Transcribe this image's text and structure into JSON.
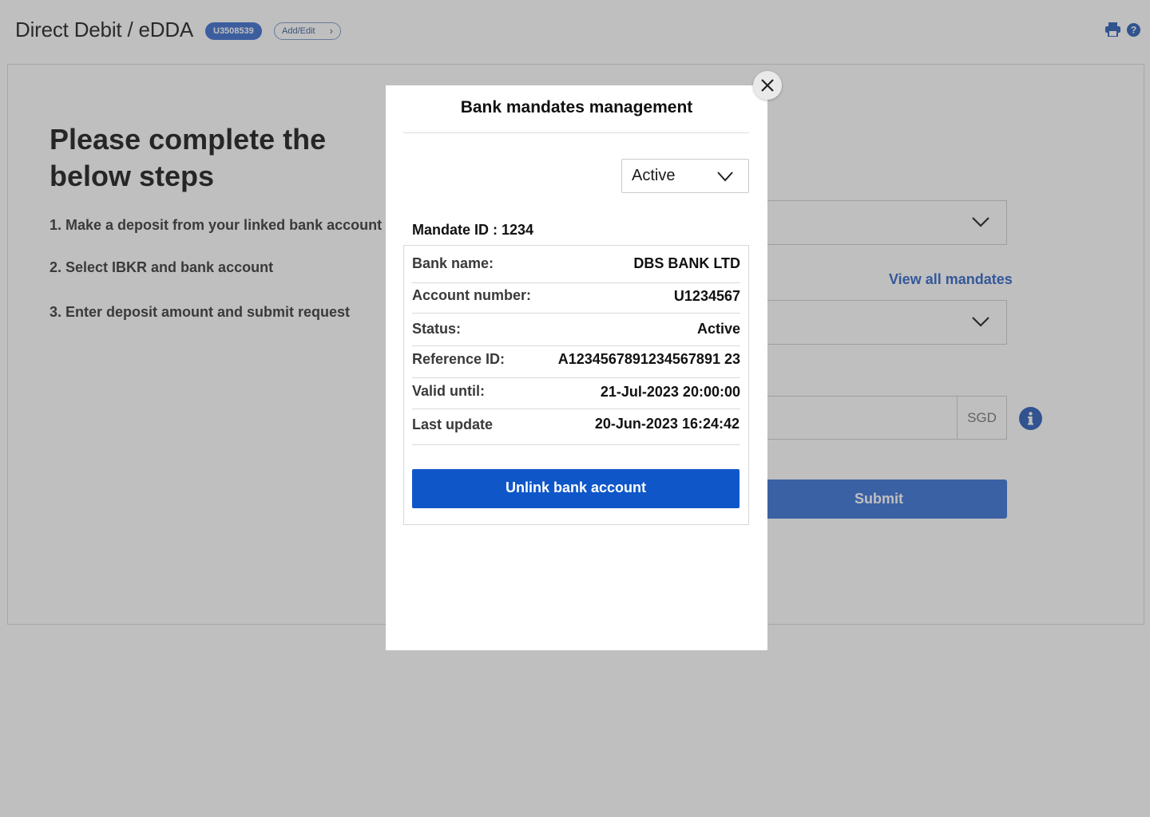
{
  "header": {
    "title": "Direct Debit / eDDA",
    "account_id": "U3508539",
    "add_edit_label": "Add/Edit"
  },
  "main": {
    "steps_title": "Please complete the below steps",
    "steps": [
      "1. Make a deposit from your linked bank account",
      "2. Select IBKR and bank account",
      "3. Enter deposit amount and submit request"
    ],
    "view_all_mandates_label": "View all mandates",
    "currency": "SGD",
    "submit_label": "Submit"
  },
  "modal": {
    "title": "Bank mandates management",
    "status_filter": "Active",
    "mandate_id_text": "Mandate ID : 1234",
    "details": [
      {
        "label": "Bank name:",
        "value": "DBS BANK LTD"
      },
      {
        "label": "Account number:",
        "value": "U1234567"
      },
      {
        "label": "Status:",
        "value": "Active"
      },
      {
        "label": "Reference ID:",
        "value": "A1234567891234567891 23"
      },
      {
        "label": "Valid until:",
        "value": "21-Jul-2023 20:00:00"
      },
      {
        "label": "Last update",
        "value": "20-Jun-2023 16:24:42"
      }
    ],
    "unlink_label": "Unlink bank account"
  },
  "colors": {
    "accent": "#0f57c9",
    "link": "#2f66c8",
    "overlay": "rgba(60,60,60,0.33)"
  },
  "icons": [
    "print-icon",
    "help-icon",
    "chevron-down-icon",
    "info-icon",
    "close-icon",
    "chevron-right-icon"
  ]
}
